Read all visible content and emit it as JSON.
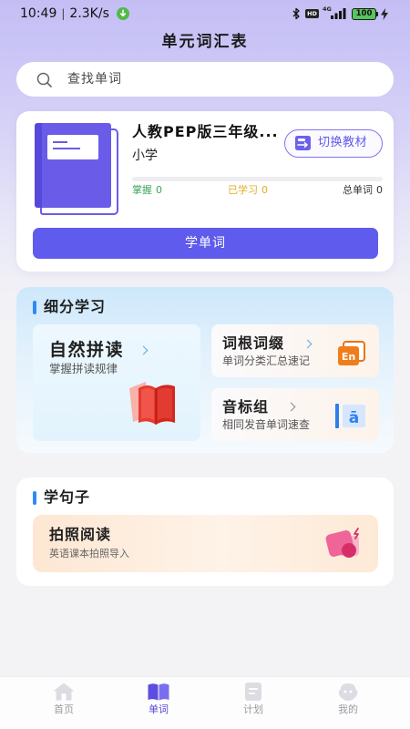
{
  "status_bar": {
    "time": "10:49",
    "separator": "|",
    "net_speed": "2.3K/s",
    "hd_badge": "HD",
    "network_type": "4G",
    "battery_level": "100"
  },
  "header": {
    "title": "单元词汇表"
  },
  "search": {
    "placeholder": "查找单词",
    "icon": "search-icon"
  },
  "textbook": {
    "title": "人教PEP版三年级...",
    "level": "小学",
    "switch_label": "切换教材",
    "progress": 0,
    "stats": [
      {
        "label": "掌握",
        "value": "0",
        "color": "#3aa65a"
      },
      {
        "label": "已学习",
        "value": "0",
        "color": "#e0ae22"
      },
      {
        "label": "总单词",
        "value": "0",
        "color": "#333333"
      }
    ],
    "study_button_label": "学单词"
  },
  "sections": {
    "detailed": {
      "title": "细分学习",
      "items": [
        {
          "title": "自然拼读",
          "subtitle": "掌握拼读规律",
          "icon": "red-book-icon"
        },
        {
          "title": "词根词缀",
          "subtitle": "单词分类汇总速记",
          "icon": "en-icon",
          "icon_text": "En"
        },
        {
          "title": "音标组",
          "subtitle": "相同发音单词速查",
          "icon": "phonetic-icon",
          "icon_text": "ā"
        }
      ]
    },
    "sentences": {
      "title": "学句子",
      "items": [
        {
          "title": "拍照阅读",
          "subtitle": "英语课本拍照导入",
          "icon": "photo-icon"
        }
      ]
    }
  },
  "bottom_nav": {
    "active_index": 1,
    "items": [
      {
        "label": "首页",
        "icon": "home-icon"
      },
      {
        "label": "单词",
        "icon": "book-icon"
      },
      {
        "label": "计划",
        "icon": "plan-icon"
      },
      {
        "label": "我的",
        "icon": "profile-icon"
      }
    ]
  },
  "colors": {
    "primary": "#5f5bec",
    "accent": "#2f8bf1",
    "header_bg": "#c4bef5",
    "page_bg": "#f3f3f6",
    "nav_active": "#5446d8",
    "nav_inactive": "#9a9aa2"
  }
}
